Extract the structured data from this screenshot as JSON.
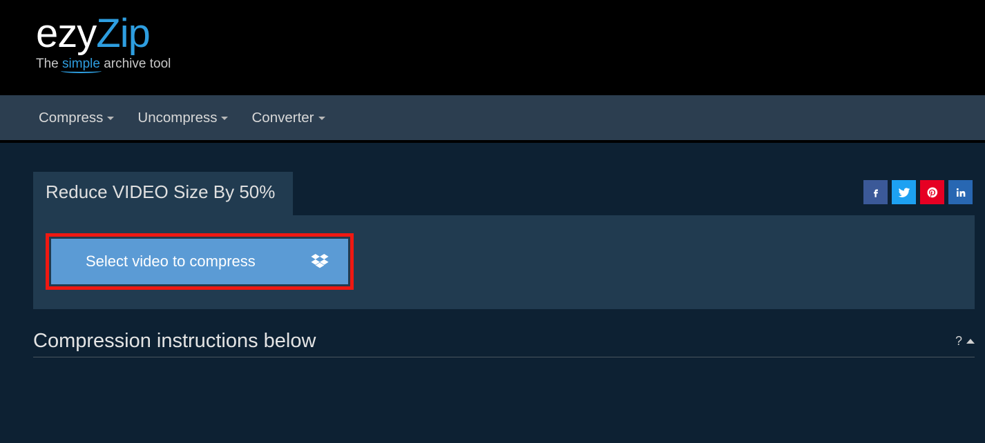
{
  "brand": {
    "name_part1": "ezy",
    "name_part2": "Zip",
    "tagline_prefix": "The ",
    "tagline_highlight": "simple",
    "tagline_suffix": " archive tool"
  },
  "nav": {
    "items": [
      {
        "label": "Compress"
      },
      {
        "label": "Uncompress"
      },
      {
        "label": "Converter"
      }
    ]
  },
  "page": {
    "title": "Reduce VIDEO Size By 50%",
    "select_button": "Select video to compress",
    "instructions_heading": "Compression instructions below",
    "help_symbol": "?"
  },
  "social": {
    "facebook": "facebook",
    "twitter": "twitter",
    "pinterest": "pinterest",
    "linkedin": "linkedin"
  }
}
